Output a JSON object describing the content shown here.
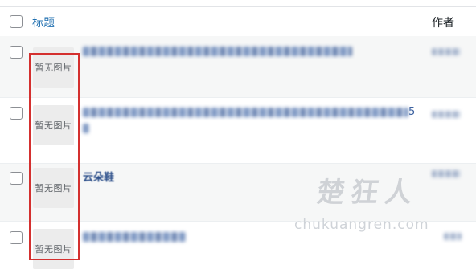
{
  "header": {
    "title_label": "标题",
    "author_label": "作者"
  },
  "rows": [
    {
      "thumb_label": "暂无图片"
    },
    {
      "thumb_label": "暂无图片",
      "title_tail": "5"
    },
    {
      "thumb_label": "暂无图片",
      "title_text": "云朵鞋"
    },
    {
      "thumb_label": "暂无图片"
    }
  ],
  "watermark": {
    "cn": "楚狂人",
    "en": "chukuangren.com"
  },
  "colors": {
    "link": "#2271b1",
    "highlight_border": "#d4302f",
    "thumb_bg": "#ececec"
  }
}
